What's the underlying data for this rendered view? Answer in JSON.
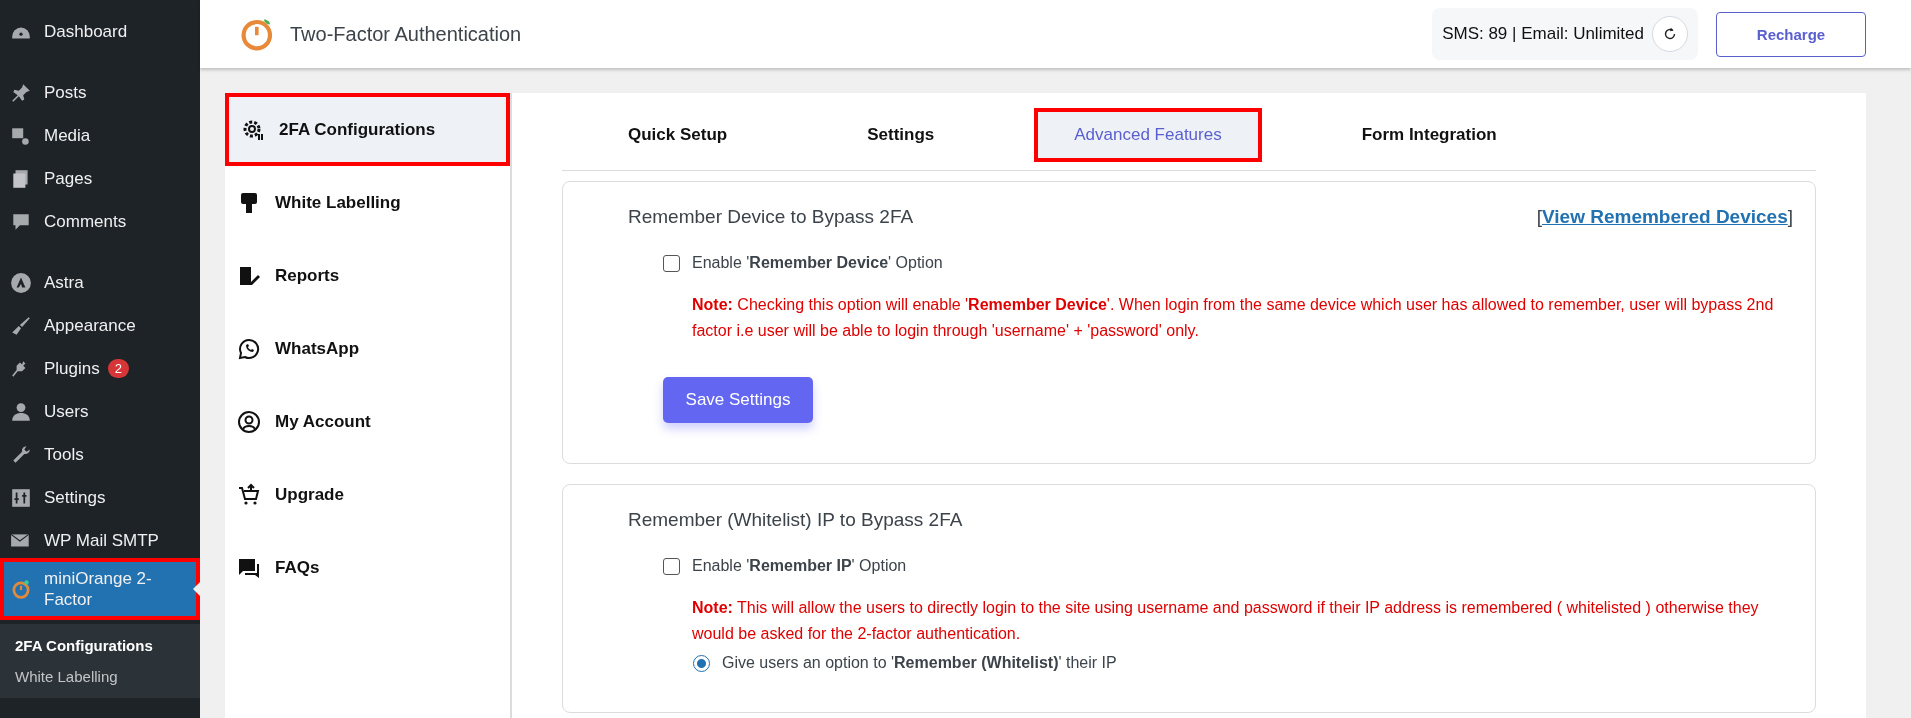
{
  "wp_menu": [
    [
      {
        "label": "Dashboard",
        "selected": false,
        "highlighted": false
      }
    ],
    [
      {
        "label": "Posts",
        "selected": false,
        "highlighted": false
      },
      {
        "label": "Media",
        "selected": false,
        "highlighted": false
      },
      {
        "label": "Pages",
        "selected": false,
        "highlighted": false
      },
      {
        "label": "Comments",
        "selected": false,
        "highlighted": false
      }
    ],
    [
      {
        "label": "Astra",
        "selected": false,
        "highlighted": false
      },
      {
        "label": "Appearance",
        "selected": false,
        "highlighted": false
      },
      {
        "label": "Plugins",
        "badge": "2",
        "selected": false,
        "highlighted": false
      },
      {
        "label": "Users",
        "selected": false,
        "highlighted": false
      },
      {
        "label": "Tools",
        "selected": false,
        "highlighted": false
      },
      {
        "label": "Settings",
        "selected": false,
        "highlighted": false
      },
      {
        "label": "WP Mail SMTP",
        "selected": false,
        "highlighted": false
      },
      {
        "label": "miniOrange 2-Factor",
        "selected": true,
        "highlighted": true
      }
    ]
  ],
  "wp_submenu": [
    {
      "label": "2FA Configurations",
      "selected": true
    },
    {
      "label": "White Labelling",
      "selected": false
    }
  ],
  "header": {
    "title": "Two-Factor Authentication",
    "credits": "SMS: 89 | Email: Unlimited",
    "button": "Recharge"
  },
  "plugin_nav": [
    {
      "label": "2FA Configurations",
      "selected": true,
      "highlighted": true
    },
    {
      "label": "White Labelling",
      "selected": false,
      "highlighted": false
    },
    {
      "label": "Reports",
      "selected": false,
      "highlighted": false
    },
    {
      "label": "WhatsApp",
      "selected": false,
      "highlighted": false
    },
    {
      "label": "My Account",
      "selected": false,
      "highlighted": false
    },
    {
      "label": "Upgrade",
      "selected": false,
      "highlighted": false
    },
    {
      "label": "FAQs",
      "selected": false,
      "highlighted": false
    }
  ],
  "tabs": [
    {
      "label": "Quick Setup",
      "selected": false,
      "highlighted": false
    },
    {
      "label": "Settings",
      "selected": false,
      "highlighted": false
    },
    {
      "label": "Advanced Features",
      "selected": true,
      "highlighted": true
    },
    {
      "label": "Form Integration",
      "selected": false,
      "highlighted": false
    }
  ],
  "sections": [
    {
      "title": "Remember Device to Bypass 2FA",
      "link": {
        "before": "[",
        "text": "View Remembered Devices",
        "after": "]"
      },
      "checkbox": {
        "label": "Enable '**Remember Device**' Option",
        "checked": false
      },
      "note": "**Note:** Checking this option will enable '**Remember Device**'. When login from the same device which user has allowed to remember, user will bypass 2nd factor i.e user will be able to login through 'username' + 'password' only.",
      "button": "Save Settings"
    },
    {
      "title": "Remember (Whitelist) IP to Bypass 2FA",
      "checkbox": {
        "label": "Enable '**Remember IP**' Option",
        "checked": false
      },
      "note": "**Note:** This will allow the users to directly login to the site using username and password if their IP address is remembered ( whitelisted ) otherwise they would be asked for the 2-factor authentication.",
      "radio": {
        "label": "Give users an option to '**Remember (Whitelist)**' their IP",
        "selected": true
      }
    }
  ]
}
